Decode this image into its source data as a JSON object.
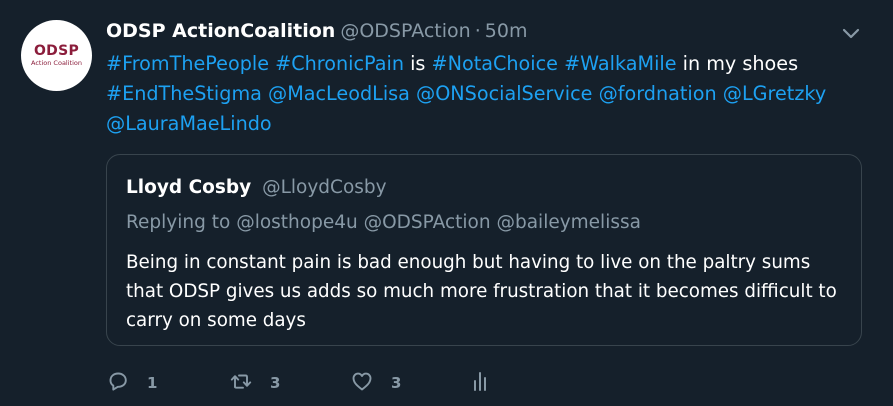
{
  "author": {
    "name": "ODSP ActionCoalition",
    "handle": "@ODSPAction",
    "separator": "·",
    "time": "50m",
    "avatar_text_main": "ODSP",
    "avatar_text_sub": "Action Coalition"
  },
  "tweet_segments": [
    {
      "text": "#FromThePeople",
      "link": true
    },
    {
      "text": " ",
      "link": false
    },
    {
      "text": "#ChronicPain",
      "link": true
    },
    {
      "text": " is ",
      "link": false
    },
    {
      "text": "#NotaChoice",
      "link": true
    },
    {
      "text": " ",
      "link": false
    },
    {
      "text": "#WalkaMile",
      "link": true
    },
    {
      "text": " in my shoes",
      "link": false
    },
    {
      "text": "\n",
      "link": false
    },
    {
      "text": "#EndTheStigma",
      "link": true
    },
    {
      "text": " ",
      "link": false
    },
    {
      "text": "@MacLeodLisa",
      "link": true
    },
    {
      "text": " ",
      "link": false
    },
    {
      "text": "@ONSocialService",
      "link": true
    },
    {
      "text": " ",
      "link": false
    },
    {
      "text": "@fordnation",
      "link": true
    },
    {
      "text": " ",
      "link": false
    },
    {
      "text": "@LGretzky",
      "link": true
    },
    {
      "text": "\n",
      "link": false
    },
    {
      "text": "@LauraMaeLindo",
      "link": true
    }
  ],
  "quoted": {
    "name": "Lloyd Cosby",
    "handle": "@LloydCosby",
    "replying_prefix": "Replying to",
    "replying_to": [
      "@losthope4u",
      "@ODSPAction",
      "@baileymelissa"
    ],
    "text": "Being in constant pain is bad enough but having to live on the paltry sums that ODSP gives us adds so much more frustration that it becomes difficult to carry on some days"
  },
  "actions": {
    "reply_count": "1",
    "retweet_count": "3",
    "like_count": "3",
    "icons": [
      "reply-icon",
      "retweet-icon",
      "like-icon",
      "analytics-icon"
    ]
  },
  "colors": {
    "background": "#15202b",
    "text": "#ffffff",
    "secondary": "#8899a6",
    "link": "#1da1f2",
    "border": "#38444d",
    "logo": "#8b1d3b"
  }
}
